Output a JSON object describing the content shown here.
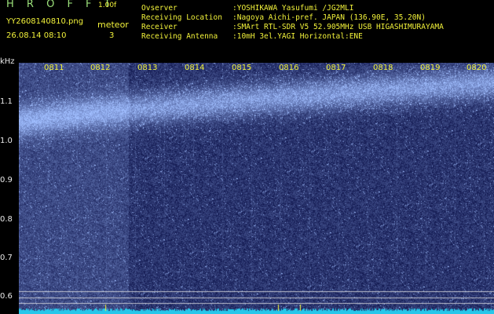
{
  "header": {
    "title": "H R O F F T",
    "version": "1.00f",
    "filename": "YY2608140810.png",
    "datetime": "26.08.14 08:10",
    "meteor_label": "meteor",
    "meteor_count": "3"
  },
  "station_info": [
    {
      "key": "Ovserver",
      "value": ":YOSHIKAWA Yasufumi /JG2MLI"
    },
    {
      "key": "Receiving Location",
      "value": ":Nagoya Aichi-pref. JAPAN (136.90E, 35.20N)"
    },
    {
      "key": "Receiver",
      "value": ":SMArt RTL-SDR V5 52.905MHz USB HIGASHIMURAYAMA"
    },
    {
      "key": "Receiving Antenna",
      "value": ":10mH 3el.YAGI Horizontal:ENE"
    }
  ],
  "axis": {
    "unit": "kHz",
    "y_ticks": [
      "1.1",
      "1.0",
      "0.9",
      "0.8",
      "0.7",
      "0.6"
    ],
    "time_labels": [
      "0811",
      "0812",
      "0813",
      "0814",
      "0815",
      "0816",
      "0817",
      "0818",
      "0819",
      "0820"
    ]
  },
  "colors": {
    "background": "#000000",
    "spectrogram_bg": "#0a0f5a",
    "signal": "#6fa0ff",
    "noise_floor": "#27c7ea",
    "label_yellow": "#f2f23a",
    "title_green": "#9be07a"
  }
}
